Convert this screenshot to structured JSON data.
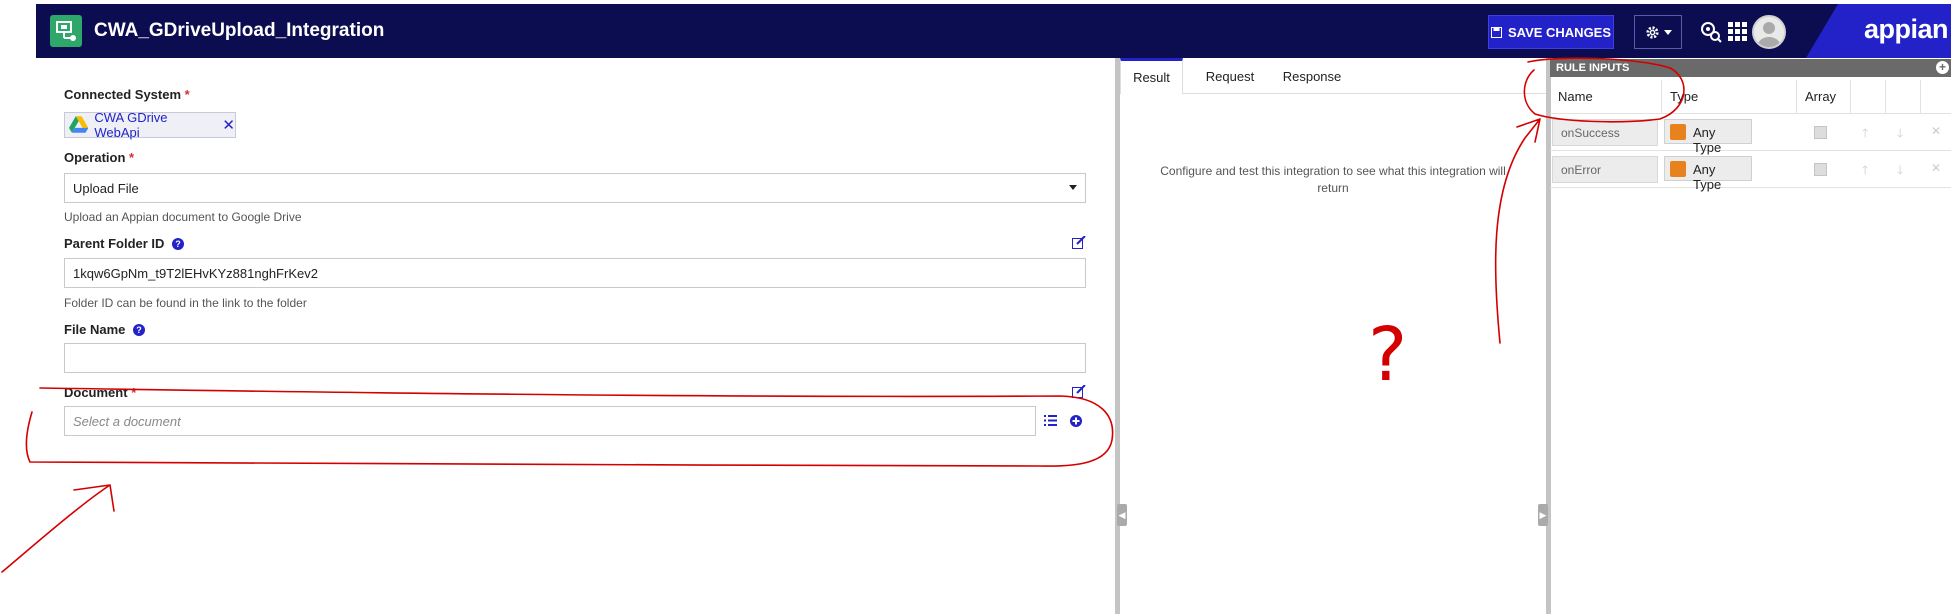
{
  "header": {
    "title": "CWA_GDriveUpload_Integration",
    "save_label": "SAVE CHANGES",
    "logo_text": "appian",
    "colors": {
      "bar": "#0c0d51",
      "accent": "#2322c8",
      "app_icon": "#2ea86a"
    }
  },
  "form": {
    "connected_system": {
      "label": "Connected System",
      "required_mark": "*",
      "chip_label": "CWA GDrive WebApi",
      "chip_icon": "google-drive-icon"
    },
    "operation": {
      "label": "Operation",
      "required_mark": "*",
      "value": "Upload File",
      "hint": "Upload an Appian document to Google Drive"
    },
    "parent_folder": {
      "label": "Parent Folder ID",
      "help": "?",
      "value": "1kqw6GpNm_t9T2lEHvKYz881nghFrKev2",
      "hint": "Folder ID can be found in the link to the folder"
    },
    "file_name": {
      "label": "File Name",
      "help": "?",
      "value": ""
    },
    "document": {
      "label": "Document",
      "required_mark": "*",
      "placeholder": "Select a document"
    }
  },
  "results": {
    "tabs": [
      "Result",
      "Request",
      "Response"
    ],
    "active_tab": "Result",
    "empty_message": "Configure and test this integration to see what this integration will return"
  },
  "rule_inputs": {
    "title": "RULE INPUTS",
    "add_symbol": "+",
    "columns": [
      "Name",
      "Type",
      "Array"
    ],
    "rows": [
      {
        "name": "onSuccess",
        "type": "Any Type",
        "array": false
      },
      {
        "name": "onError",
        "type": "Any Type",
        "array": false
      }
    ]
  },
  "annotation": {
    "mark": "?",
    "color": "#d40000"
  }
}
